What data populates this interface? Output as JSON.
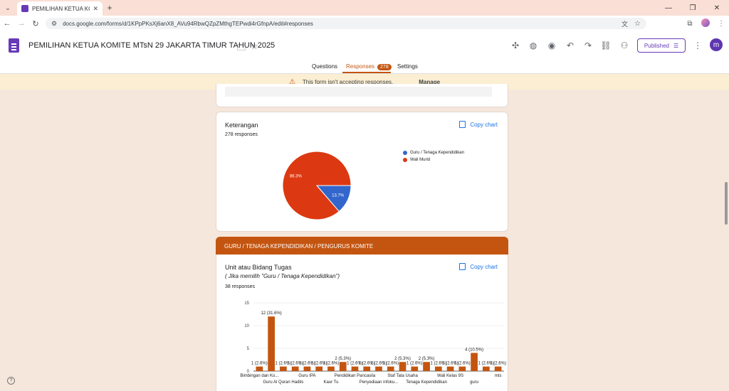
{
  "browser": {
    "tab_title": "PEMILIHAN KETUA KOMITE MTs",
    "url": "docs.google.com/forms/d/1KPpPKsXj6anX8_AVu94RbwQZpZMthgTEPwdi4rGfnpA/edit#responses"
  },
  "form": {
    "title": "PEMILIHAN KETUA KOMITE MTsN 29 JAKARTA TIMUR TAHUN 2025",
    "published_label": "Published",
    "avatar_letter": "m",
    "tabs": {
      "questions": "Questions",
      "responses": "Responses",
      "responses_count": "278",
      "settings": "Settings"
    }
  },
  "banner": {
    "text": "This form isn't accepting responses.",
    "manage": "Manage"
  },
  "copy_chart_label": "Copy chart",
  "section_title": "GURU / TENAGA KEPENDIDIKAN / PENGURUS KOMITE",
  "card1": {
    "title": "Keterangan",
    "responses": "278 responses"
  },
  "card2": {
    "title": "Unit atau Bidang Tugas",
    "subtitle": "( Jika memilih \"Guru / Tenaga Kependidikan\")",
    "responses": "38 responses"
  },
  "colors": {
    "accent": "#c45510",
    "pie_blue": "#3366cc",
    "pie_red": "#dc3912",
    "bar": "#c45510"
  },
  "chart_data": [
    {
      "type": "pie",
      "labels": [
        "Guru / Tenaga Kependidikan",
        "Wali Murid"
      ],
      "values": [
        13.7,
        86.3
      ],
      "slice_labels": [
        "13.7%",
        "86.3%"
      ],
      "legend": "right"
    },
    {
      "type": "bar",
      "ylim": [
        0,
        15
      ],
      "yticks": [
        0,
        5,
        10,
        15
      ],
      "values": [
        1,
        12,
        1,
        1,
        1,
        1,
        1,
        2,
        1,
        1,
        1,
        1,
        2,
        1,
        2,
        1,
        1,
        1,
        4,
        1,
        1
      ],
      "data_labels": [
        "1 (2.6%)",
        "12 (31.6%)",
        "1 (2.6%)",
        "1 (2.6%)",
        "1 (2.6%)",
        "1 (2.6%)",
        "1 (2.6%)",
        "2 (5.3%)",
        "1 (2.6%)",
        "1 (2.6%)",
        "1 (2.6%)",
        "1 (2.6%)",
        "2 (5.3%)",
        "1 (2.6%)",
        "2 (5.3%)",
        "1 (2.6%)",
        "1 (2.6%)",
        "1 (2.6%)",
        "4 (10.5%)",
        "1 (2.6%)",
        "1 (2.6%)"
      ],
      "x_labels_top": [
        {
          "text": "Bimbingan dan Ko...",
          "index": 0
        },
        {
          "text": "Guru IPA",
          "index": 4
        },
        {
          "text": "Pendidikan Pancasila",
          "index": 8
        },
        {
          "text": "Staf Tata Usaha",
          "index": 12
        },
        {
          "text": "Wali Kelas 9S",
          "index": 16
        },
        {
          "text": "mts",
          "index": 20
        }
      ],
      "x_labels_bottom": [
        {
          "text": "Guru Al Quran Hadits",
          "index": 2
        },
        {
          "text": "Kaur Tu",
          "index": 6
        },
        {
          "text": "Penyediaan infoku...",
          "index": 10
        },
        {
          "text": "Tenaga Kependidikan",
          "index": 14
        },
        {
          "text": "guru",
          "index": 18
        }
      ],
      "grid": true
    }
  ]
}
